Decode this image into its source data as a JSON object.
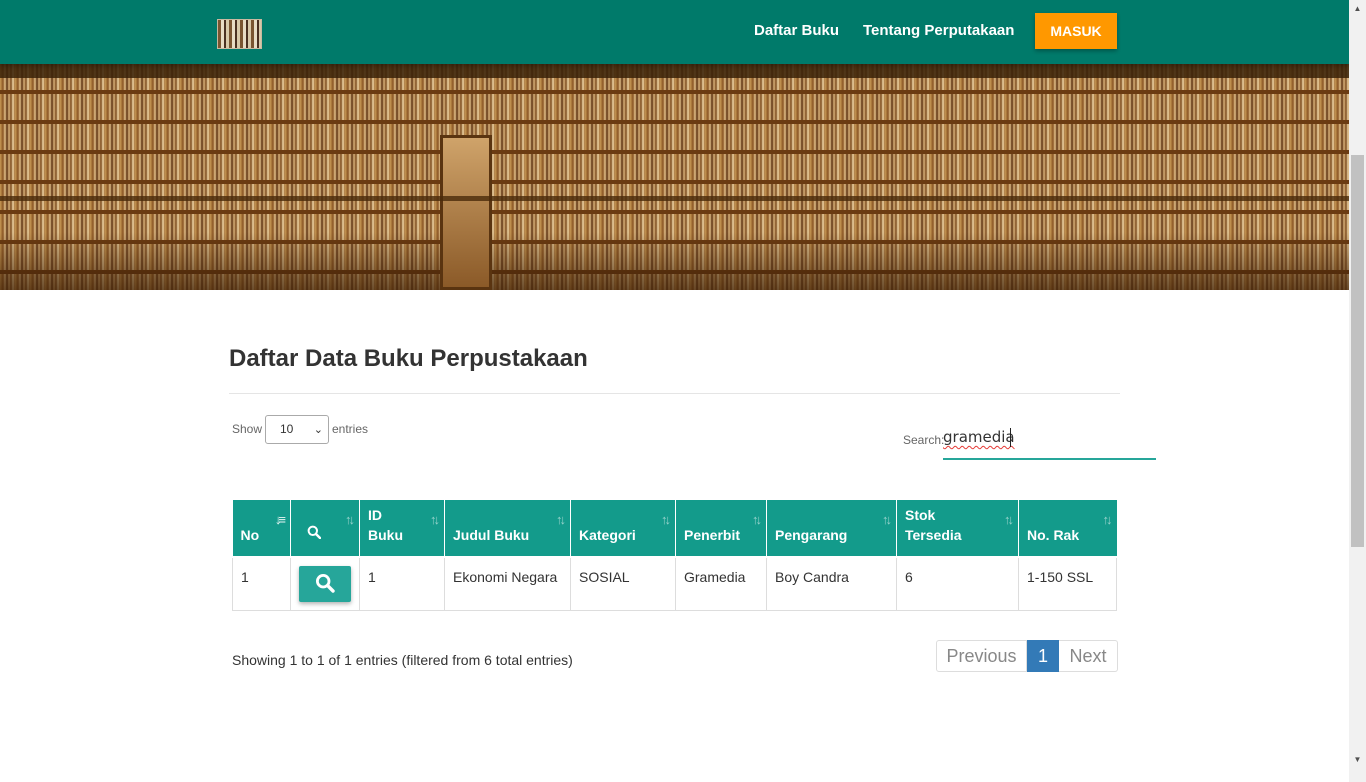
{
  "navbar": {
    "logo_icon": "library-logo",
    "links": [
      "Daftar Buku",
      "Tentang Perputakaan"
    ],
    "login_button": "MASUK",
    "color": "#007a6a",
    "login_color": "#ff9800"
  },
  "main": {
    "title": "Daftar Data Buku Perpustakaan",
    "length_control": {
      "show_label": "Show",
      "selected": "10",
      "entries_label": "entries"
    },
    "search": {
      "label": "Search:",
      "value": "gramedia"
    },
    "table": {
      "header_color": "#139b8b",
      "columns": [
        {
          "line1": "",
          "line2": "No"
        },
        {
          "line1": "",
          "line2": "",
          "icon": "search-icon"
        },
        {
          "line1": "ID",
          "line2": "Buku"
        },
        {
          "line1": "",
          "line2": "Judul Buku"
        },
        {
          "line1": "",
          "line2": "Kategori"
        },
        {
          "line1": "",
          "line2": "Penerbit"
        },
        {
          "line1": "",
          "line2": "Pengarang"
        },
        {
          "line1": "Stok",
          "line2": "Tersedia"
        },
        {
          "line1": "",
          "line2": "No. Rak"
        }
      ],
      "rows": [
        {
          "no": "1",
          "action_icon": "search-icon",
          "id_buku": "1",
          "judul": "Ekonomi Negara",
          "kategori": "SOSIAL",
          "penerbit": "Gramedia",
          "pengarang": "Boy Candra",
          "stok": "6",
          "rak": "1-150 SSL"
        }
      ]
    },
    "info": "Showing 1 to 1 of 1 entries (filtered from 6 total entries)",
    "pagination": {
      "previous": "Previous",
      "current": "1",
      "next": "Next",
      "active_color": "#337ab7"
    }
  }
}
